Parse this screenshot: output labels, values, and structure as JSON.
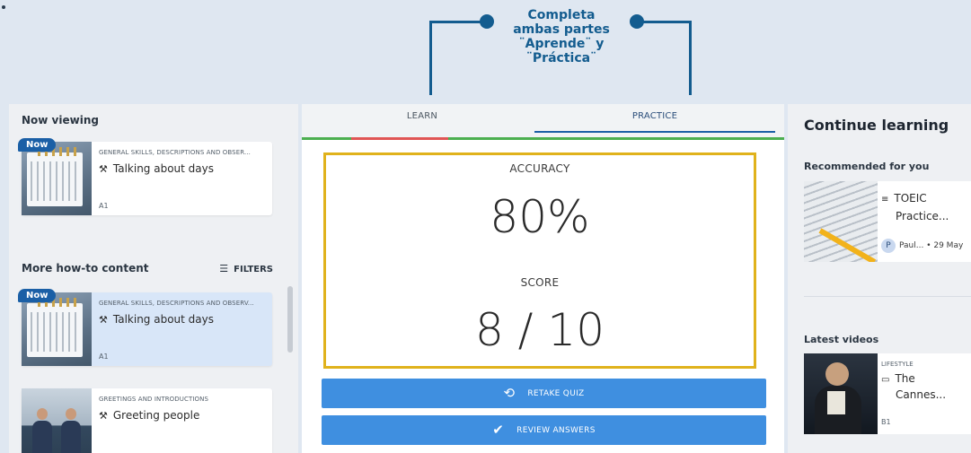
{
  "annotation": {
    "text_lines": [
      "Completa",
      "ambas partes",
      "¨Aprende¨ y",
      "¨Práctica¨"
    ]
  },
  "left": {
    "now_viewing_title": "Now viewing",
    "more_title": "More how-to content",
    "filters_label": "FILTERS",
    "now_badge": "Now",
    "now_card": {
      "category": "GENERAL SKILLS, DESCRIPTIONS AND OBSER...",
      "title": "Talking about days",
      "level": "A1"
    },
    "list": [
      {
        "badge": "Now",
        "category": "GENERAL SKILLS, DESCRIPTIONS AND OBSERV...",
        "title": "Talking about days",
        "level": "A1"
      },
      {
        "category": "GREETINGS AND INTRODUCTIONS",
        "title": "Greeting people"
      }
    ]
  },
  "tabs": {
    "learn": "LEARN",
    "practice": "PRACTICE"
  },
  "results": {
    "accuracy_label": "ACCURACY",
    "accuracy_value": "80%",
    "score_label": "SCORE",
    "score_value": "8 / 10"
  },
  "buttons": {
    "retake": "RETAKE QUIZ",
    "review": "REVIEW ANSWERS"
  },
  "right": {
    "title": "Continue learning",
    "recommended_title": "Recommended for you",
    "recommended_card": {
      "title_line1": "TOEIC",
      "title_line2": "Practice...",
      "author_initial": "P",
      "author": "Paul...",
      "date": "• 29 May"
    },
    "latest_title": "Latest videos",
    "video_card": {
      "category": "LIFESTYLE",
      "title_line1": "The",
      "title_line2": "Cannes...",
      "level": "B1"
    }
  },
  "colors": {
    "accent_blue": "#1a5fa6",
    "button_blue": "#3f8fe0",
    "highlight_border": "#e0b21c",
    "annotation": "#135c8f",
    "progress_green": "#4caf50",
    "progress_red": "#e05555"
  }
}
